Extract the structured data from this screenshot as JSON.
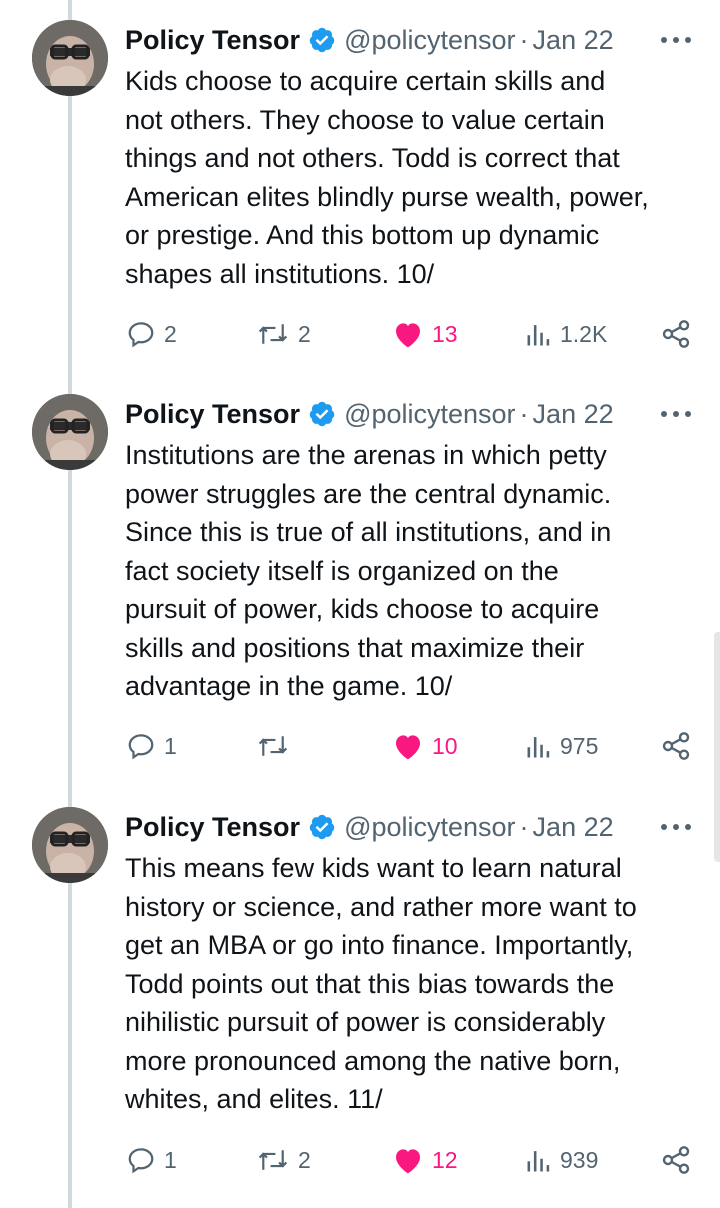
{
  "tweets": [
    {
      "name": "Policy Tensor",
      "handle": "@policytensor",
      "separator": "·",
      "date": "Jan 22",
      "text": "Kids choose to acquire certain skills and\nnot others. They choose to value certain\nthings and not others. Todd is correct that\nAmerican elites blindly purse wealth, power,\nor prestige. And this bottom up dynamic\nshapes all institutions. 10/",
      "replies": "2",
      "retweets": "2",
      "likes": "13",
      "views": "1.2K"
    },
    {
      "name": "Policy Tensor",
      "handle": "@policytensor",
      "separator": "·",
      "date": "Jan 22",
      "text": "Institutions are the arenas in which petty\npower struggles are the central dynamic.\nSince this is true of all institutions, and in\nfact society itself is organized on the\npursuit of power, kids choose to acquire\nskills and positions that maximize their\nadvantage in the game. 10/",
      "replies": "1",
      "retweets": "",
      "likes": "10",
      "views": "975"
    },
    {
      "name": "Policy Tensor",
      "handle": "@policytensor",
      "separator": "·",
      "date": "Jan 22",
      "text": "This means few kids want to learn natural\nhistory or science, and rather more want to\nget an MBA or go into finance. Importantly,\nTodd points out that this bias towards the\nnihilistic pursuit of power is considerably\nmore pronounced among the native born,\nwhites, and elites. 11/",
      "replies": "1",
      "retweets": "2",
      "likes": "12",
      "views": "939"
    }
  ],
  "colors": {
    "verified": "#1d9bf0",
    "like": "#f91880",
    "secondary": "#536471",
    "thread_line": "#cfd9de"
  },
  "icons": [
    "reply-icon",
    "retweet-icon",
    "heart-icon",
    "views-icon",
    "share-icon",
    "more-icon",
    "verified-badge-icon"
  ]
}
